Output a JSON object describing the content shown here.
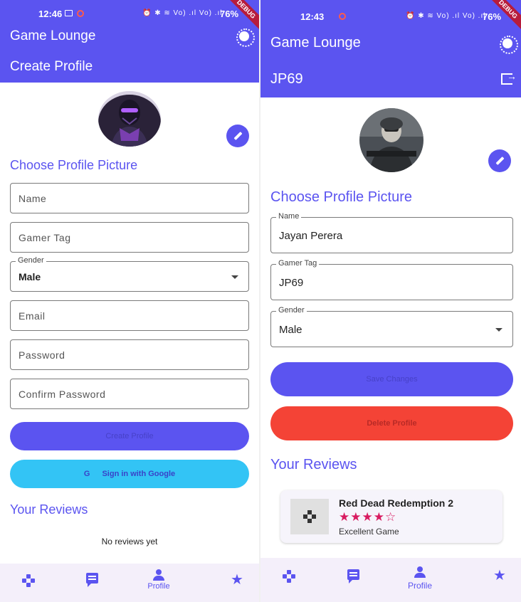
{
  "colors": {
    "primary": "#5b54f0",
    "google": "#33c4f5",
    "delete": "#f44336",
    "stars": "#d81b60"
  },
  "left": {
    "status": {
      "time": "12:46",
      "battery": "76%",
      "icons": "⏰ ✱ ≋ Vo) .ıl Vo) .ıl",
      "debug": "DEBUG"
    },
    "app_title": "Game Lounge",
    "sub_title": "Create Profile",
    "choose_picture": "Choose Profile Picture",
    "fields": {
      "name_placeholder": "Name",
      "gamer_tag_placeholder": "Gamer Tag",
      "gender_label": "Gender",
      "gender_value": "Male",
      "email_placeholder": "Email",
      "password_placeholder": "Password",
      "confirm_password_placeholder": "Confirm Password"
    },
    "buttons": {
      "create_profile": "Create Profile",
      "google_icon": "G",
      "google": "Sign in with Google"
    },
    "reviews_heading": "Your Reviews",
    "no_reviews": "No reviews yet",
    "nav": {
      "profile_label": "Profile"
    }
  },
  "right": {
    "status": {
      "time": "12:43",
      "battery": "76%",
      "icons": "⏰ ✱ ≋ Vo) .ıl Vo) .ıl",
      "debug": "DEBUG"
    },
    "app_title": "Game Lounge",
    "sub_title": "JP69",
    "choose_picture": "Choose Profile Picture",
    "fields": {
      "name_label": "Name",
      "name_value": "Jayan Perera",
      "gamer_tag_label": "Gamer Tag",
      "gamer_tag_value": "JP69",
      "gender_label": "Gender",
      "gender_value": "Male"
    },
    "buttons": {
      "save": "Save Changes",
      "delete": "Delete Profile"
    },
    "reviews_heading": "Your Reviews",
    "reviews": [
      {
        "title": "Red Dead Redemption 2",
        "stars": "★★★★☆",
        "rating": 4,
        "comment": "Excellent Game"
      }
    ],
    "nav": {
      "profile_label": "Profile"
    }
  }
}
